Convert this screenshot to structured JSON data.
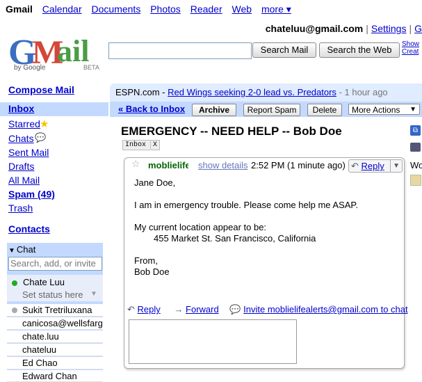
{
  "topnav": {
    "brand": "Gmail",
    "links": [
      "Calendar",
      "Documents",
      "Photos",
      "Reader",
      "Web"
    ],
    "more": "more ▾"
  },
  "account": {
    "email": "chateluu@gmail.com",
    "settings": "Settings",
    "more_sep": "|",
    "clipped": "G"
  },
  "logo": {
    "by_google": "by Google",
    "beta": "BETA"
  },
  "search": {
    "value": "",
    "mail_button": "Search Mail",
    "web_button": "Search the Web",
    "show_options": "Show",
    "create_filter": "Creat"
  },
  "sidebar": {
    "compose": "Compose Mail",
    "inbox": "Inbox",
    "items": [
      "Starred",
      "Chats",
      "Sent Mail",
      "Drafts",
      "All Mail",
      "Spam (49)",
      "Trash"
    ],
    "contacts": "Contacts"
  },
  "chat": {
    "header": "Chat",
    "search_placeholder": "Search, add, or invite",
    "me": {
      "name": "Chate Luu",
      "status": "Set status here"
    },
    "contacts": [
      "Sukit Tretriluxana",
      "canicosa@wellsfarg",
      "chate.luu",
      "chateluu",
      "Ed Chao",
      "Edward Chan"
    ],
    "colors": {
      "online": "#22aa22",
      "idle": "#aaaaaa"
    }
  },
  "webclip": {
    "source": "ESPN.com -",
    "headline": "Red Wings seeking 2-0 lead vs. Predators",
    "age": "- 1 hour ago"
  },
  "toolbar": {
    "back": "« Back to Inbox",
    "archive": "Archive",
    "report_spam": "Report Spam",
    "delete": "Delete",
    "more_actions": "More Actions"
  },
  "message": {
    "subject": "EMERGENCY -- NEED HELP -- Bob Doe",
    "label": "Inbox",
    "label_x": "X",
    "sender": "moblielifealerts",
    "show_details": "show details",
    "time": "2:52 PM (1 minute ago)",
    "reply": "Reply",
    "greeting": "Jane Doe,",
    "line1": "I am in emergency trouble.  Please come help me ASAP.",
    "line2": "My current location appear to be:",
    "address": "455 Market St. San Francisco, California",
    "signoff": "From,",
    "signature": "Bob Doe",
    "reply_link": "Reply",
    "forward_link": "Forward",
    "invite_link": "Invite moblielifealerts@gmail.com to chat"
  },
  "rightcol": {
    "label": "Wo"
  },
  "colors": {
    "accent": "#c3d9ff",
    "link": "#0000cc",
    "sender": "#006600",
    "logo_red": "#d44638",
    "logo_blue": "#3b6ec0"
  }
}
